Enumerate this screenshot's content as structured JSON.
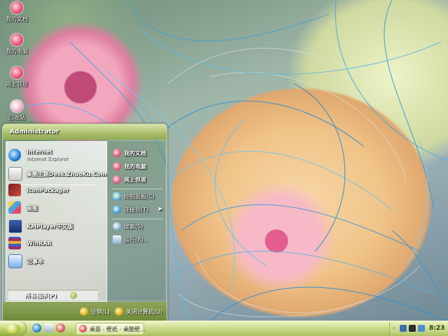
{
  "desktop": {
    "icons": [
      {
        "label": "我的文档",
        "icon": "my-documents-icon"
      },
      {
        "label": "我的电脑",
        "icon": "my-computer-icon"
      },
      {
        "label": "网上邻居",
        "icon": "network-places-icon"
      },
      {
        "label": "回收站",
        "icon": "recycle-bin-icon"
      }
    ]
  },
  "start_menu": {
    "user": "Administrator",
    "programs": [
      {
        "title": "Internet",
        "subtitle": "Internet Explorer",
        "icon": "internet-explorer-icon"
      },
      {
        "title": "桌酷主题Desk.ZhuoKu.Com",
        "subtitle": "",
        "icon": "zhuoku-theme-icon"
      },
      {
        "title": "IconPackager",
        "subtitle": "",
        "icon": "iconpackager-icon"
      },
      {
        "title": "画图",
        "subtitle": "",
        "icon": "paint-icon"
      },
      {
        "title": "KMPlayer中文版",
        "subtitle": "",
        "icon": "kmplayer-icon"
      },
      {
        "title": "WinRAR",
        "subtitle": "",
        "icon": "winrar-icon"
      },
      {
        "title": "记事本",
        "subtitle": "",
        "icon": "notepad-icon"
      }
    ],
    "all_programs": "所有程序(P)",
    "places": [
      {
        "label": "我的文档",
        "icon": "my-documents-icon"
      },
      {
        "label": "我的电脑",
        "icon": "my-computer-icon"
      },
      {
        "label": "网上邻居",
        "icon": "network-places-icon"
      }
    ],
    "settings": [
      {
        "label": "控制面板(C)",
        "icon": "control-panel-icon"
      },
      {
        "label": "连接到(T)",
        "icon": "connect-to-icon",
        "submenu": true
      }
    ],
    "tools": [
      {
        "label": "搜索(S)",
        "icon": "search-icon"
      },
      {
        "label": "运行(R)...",
        "icon": "run-icon"
      }
    ],
    "logoff": "注销(L)",
    "shutdown": "关闭计算机(U)"
  },
  "taskbar": {
    "task_label": "桌面 - 壁纸 - 桌酷壁...",
    "clock": "8:23"
  },
  "colors": {
    "taskbar": "#c9d98a",
    "start_menu_header": "#a8bd6a",
    "start_menu_footer": "#7f9a45"
  }
}
